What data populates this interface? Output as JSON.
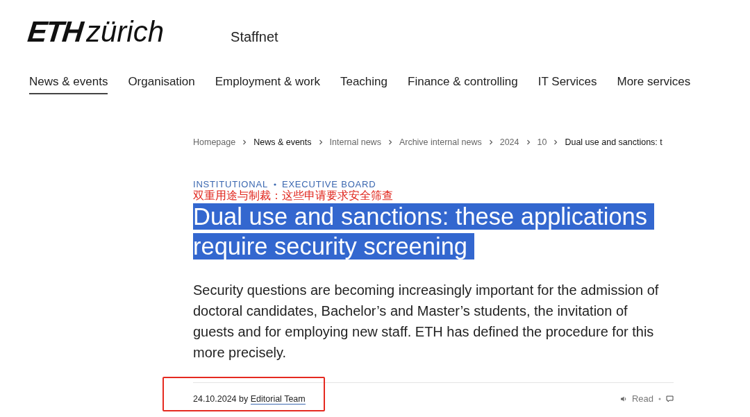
{
  "header": {
    "logo": {
      "bold": "ETH",
      "light": "zürich"
    },
    "site_name": "Staffnet"
  },
  "nav": [
    {
      "label": "News & events",
      "selected": true
    },
    {
      "label": "Organisation",
      "selected": false
    },
    {
      "label": "Employment & work",
      "selected": false
    },
    {
      "label": "Teaching",
      "selected": false
    },
    {
      "label": "Finance & controlling",
      "selected": false
    },
    {
      "label": "IT Services",
      "selected": false
    },
    {
      "label": "More services",
      "selected": false
    }
  ],
  "breadcrumb": [
    {
      "label": "Homepage",
      "current": false
    },
    {
      "label": "News & events",
      "current": true
    },
    {
      "label": "Internal news",
      "current": false
    },
    {
      "label": "Archive internal news",
      "current": false
    },
    {
      "label": "2024",
      "current": false
    },
    {
      "label": "10",
      "current": false
    },
    {
      "label": "Dual use and sanctions: t",
      "current": true
    }
  ],
  "article": {
    "categories": [
      "INSTITUTIONAL",
      "EXECUTIVE BOARD"
    ],
    "translation_note": "双重用途与制裁：这些申请要求安全筛查",
    "title_lines": [
      "Dual use and sanctions: these applications",
      "require security screening"
    ],
    "title_selected": true,
    "lead": "Security questions are becoming increasingly important for the admission of doctoral candidates, Bachelor’s and Master’s students, the invitation of guests and for employing new staff. ETH has defined the procedure for this more precisely.",
    "date": "24.10.2024",
    "by": "by",
    "author": "Editorial Team",
    "read_label": "Read",
    "meta_highlighted": true
  }
}
